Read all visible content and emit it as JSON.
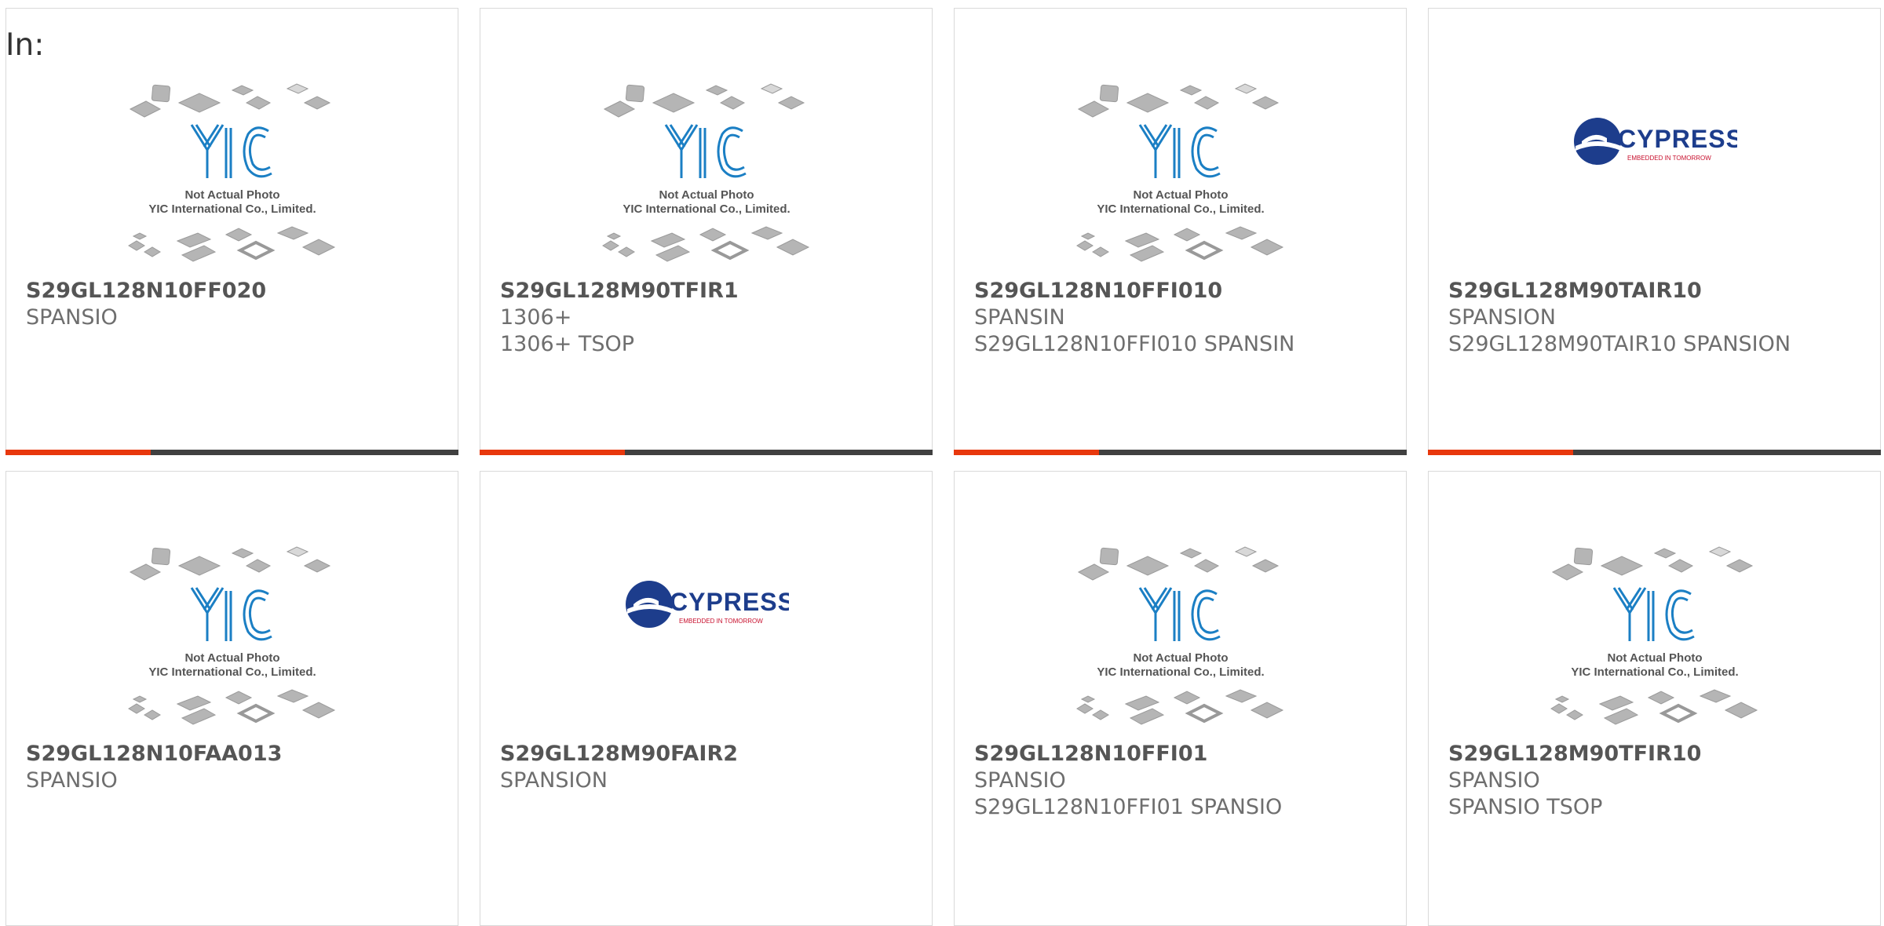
{
  "header": {
    "in_label": "In:"
  },
  "image_placeholder": {
    "line1": "Not Actual Photo",
    "line2": "YIC International Co., Limited.",
    "logo_text": "YIC"
  },
  "cypress_logo": {
    "name": "CYPRESS",
    "tagline": "EMBEDDED IN TOMORROW"
  },
  "colors": {
    "accent": "#e8380d",
    "bar_dark": "#404040",
    "logo_blue": "#1b7fc4",
    "cypress_navy": "#1d3d8c",
    "cypress_red": "#c8102e"
  },
  "products": [
    {
      "part": "S29GL128N10FF020",
      "line1": "SPANSIO",
      "line2": "",
      "image": "yic-placeholder"
    },
    {
      "part": "S29GL128M90TFIR1",
      "line1": "1306+",
      "line2": "1306+ TSOP",
      "image": "yic-placeholder"
    },
    {
      "part": "S29GL128N10FFI010",
      "line1": "SPANSIN",
      "line2": "S29GL128N10FFI010 SPANSIN",
      "image": "yic-placeholder"
    },
    {
      "part": "S29GL128M90TAIR10",
      "line1": "SPANSION",
      "line2": "S29GL128M90TAIR10 SPANSION",
      "image": "cypress-logo"
    },
    {
      "part": "S29GL128N10FAA013",
      "line1": "SPANSIO",
      "line2": "",
      "image": "yic-placeholder"
    },
    {
      "part": "S29GL128M90FAIR2",
      "line1": "SPANSION",
      "line2": "",
      "image": "cypress-logo"
    },
    {
      "part": "S29GL128N10FFI01",
      "line1": "SPANSIO",
      "line2": "S29GL128N10FFI01 SPANSIO",
      "image": "yic-placeholder"
    },
    {
      "part": "S29GL128M90TFIR10",
      "line1": "SPANSIO",
      "line2": "SPANSIO TSOP",
      "image": "yic-placeholder"
    }
  ]
}
